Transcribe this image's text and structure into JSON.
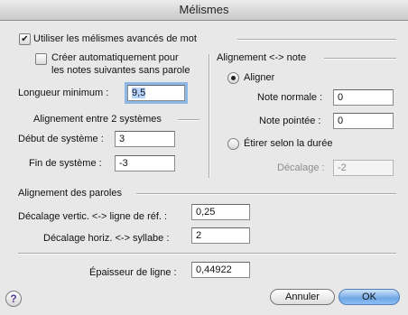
{
  "window": {
    "title": "Mélismes"
  },
  "advanced": {
    "label": "Utiliser les mélismes avancés de mot",
    "checked": true
  },
  "auto_create": {
    "line1": "Créer automatiquement pour",
    "line2": "les notes suivantes sans parole",
    "checked": false
  },
  "min_length": {
    "label": "Longueur minimum :",
    "value": "9,5"
  },
  "systems": {
    "heading": "Alignement entre 2 systèmes",
    "start_label": "Début de système :",
    "start_value": "3",
    "end_label": "Fin de système :",
    "end_value": "-3"
  },
  "note_align": {
    "heading": "Alignement <-> note",
    "align_label": "Aligner",
    "align_selected": true,
    "normal_label": "Note normale :",
    "normal_value": "0",
    "dotted_label": "Note pointée :",
    "dotted_value": "0",
    "stretch_label": "Étirer selon la durée",
    "stretch_selected": false,
    "offset_label": "Décalage :",
    "offset_value": "-2"
  },
  "lyrics": {
    "heading": "Alignement des paroles",
    "vert_label": "Décalage vertic. <-> ligne de réf. :",
    "vert_value": "0,25",
    "horiz_label": "Décalage horiz. <-> syllabe :",
    "horiz_value": "2"
  },
  "thickness": {
    "label": "Épaisseur de ligne :",
    "value": "0,44922"
  },
  "buttons": {
    "help": "?",
    "cancel": "Annuler",
    "ok": "OK"
  }
}
